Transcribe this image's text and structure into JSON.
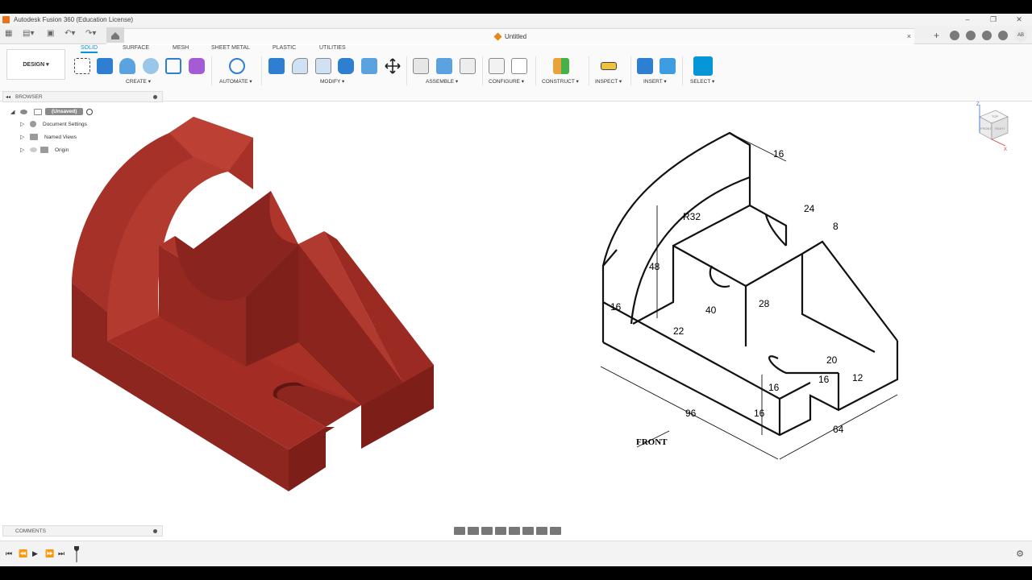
{
  "titlebar": {
    "title": "Autodesk Fusion 360 (Education License)"
  },
  "document": {
    "title": "Untitled",
    "close": "×"
  },
  "user": {
    "initials": "AB"
  },
  "workspace": {
    "label": "DESIGN ▾"
  },
  "ribbon": {
    "tabs": [
      "SOLID",
      "SURFACE",
      "MESH",
      "SHEET METAL",
      "PLASTIC",
      "UTILITIES"
    ],
    "groups": [
      "CREATE ▾",
      "AUTOMATE ▾",
      "MODIFY ▾",
      "ASSEMBLE ▾",
      "CONFIGURE ▾",
      "CONSTRUCT ▾",
      "INSPECT ▾",
      "INSERT ▾",
      "SELECT ▾"
    ]
  },
  "browser": {
    "title": "BROWSER",
    "root": "(Unsaved)",
    "items": [
      "Document Settings",
      "Named Views",
      "Origin"
    ]
  },
  "comments": {
    "title": "COMMENTS"
  },
  "viewcube": {
    "front": "FRONT",
    "right": "RIGHT",
    "top": "TOP",
    "z": "Z",
    "x": "X"
  },
  "drawing": {
    "dims": [
      "16",
      "R32",
      "24",
      "8",
      "48",
      "16",
      "40",
      "28",
      "22",
      "20",
      "16",
      "16",
      "12",
      "96",
      "16",
      "64"
    ],
    "front_label": "FRONT"
  },
  "colors": {
    "accent": "#0696d7",
    "model": "#9e2b22",
    "model_light": "#b53a2e",
    "model_dark": "#7d1f18"
  }
}
